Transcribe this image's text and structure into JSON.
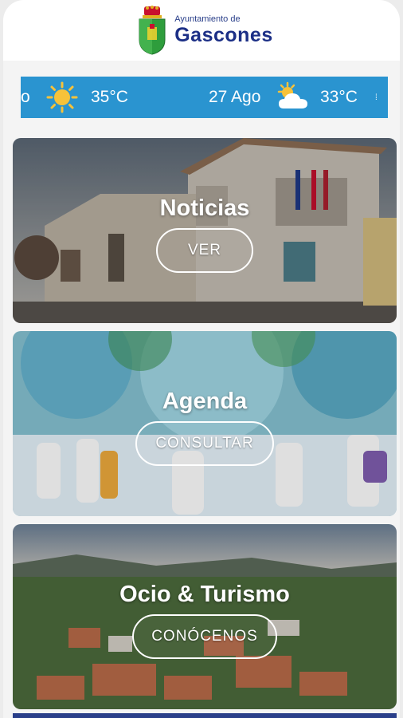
{
  "header": {
    "subtitle": "Ayuntamiento de",
    "title": "Gascones",
    "crest_icon": "coat-of-arms-icon"
  },
  "weather": {
    "items": [
      {
        "label": "o",
        "icon": "sun-icon",
        "temp": "35°C"
      },
      {
        "label": "27 Ago",
        "icon": "cloud-sun-icon",
        "temp": "33°C"
      }
    ],
    "accent": "#2a94d0"
  },
  "cards": [
    {
      "title": "Noticias",
      "button": "VER"
    },
    {
      "title": "Agenda",
      "button": "CONSULTAR"
    },
    {
      "title": "Ocio & Turismo",
      "button": "CONÓCENOS"
    }
  ]
}
